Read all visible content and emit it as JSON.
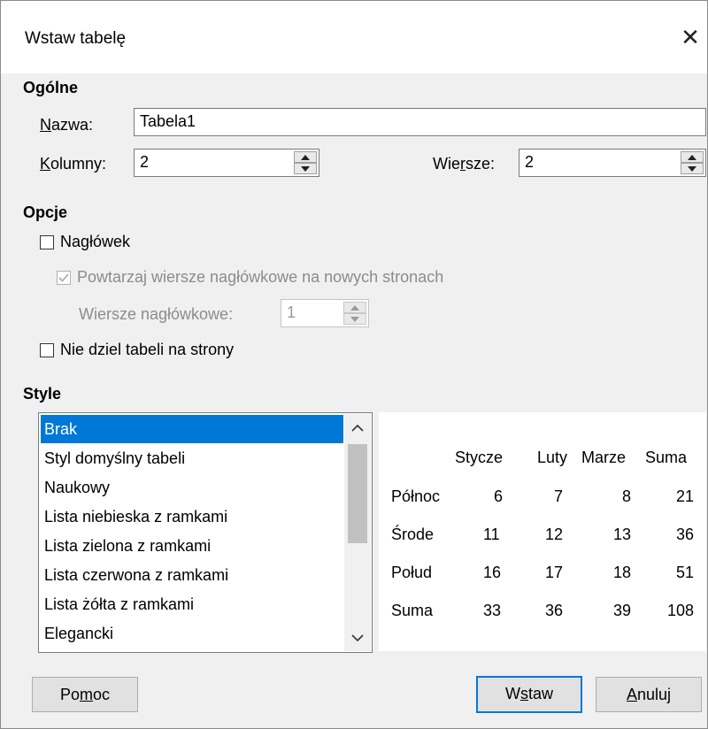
{
  "window": {
    "title": "Wstaw tabelę",
    "close_glyph": "✕"
  },
  "general": {
    "heading": "Ogólne",
    "name_label": "Nazwa:",
    "name_value": "Tabela1",
    "columns_label": "Kolumny:",
    "columns_value": "2",
    "rows_label": "Wiersze:",
    "rows_value": "2"
  },
  "options": {
    "heading": "Opcje",
    "header_checkbox": {
      "label": "Nagłówek",
      "checked": false
    },
    "repeat_header": {
      "label": "Powtarzaj wiersze nagłówkowe na nowych stronach",
      "checked": true,
      "disabled": true
    },
    "heading_rows_label": "Wiersze nagłówkowe:",
    "heading_rows_value": "1",
    "dont_split": {
      "label": "Nie dziel tabeli na strony",
      "checked": false
    }
  },
  "styles": {
    "heading": "Style",
    "items": [
      "Brak",
      "Styl domyślny tabeli",
      "Naukowy",
      "Lista niebieska z ramkami",
      "Lista zielona z ramkami",
      "Lista czerwona z ramkami",
      "Lista żółta z ramkami",
      "Elegancki"
    ],
    "selected_index": 0
  },
  "preview": {
    "columns": [
      "Stycze",
      "Luty",
      "Marze",
      "Suma"
    ],
    "rows": [
      {
        "label": "Północ",
        "values": [
          "6",
          "7",
          "8",
          "21"
        ]
      },
      {
        "label": "Środe",
        "values": [
          "11",
          "12",
          "13",
          "36"
        ]
      },
      {
        "label": "Połud",
        "values": [
          "16",
          "17",
          "18",
          "51"
        ]
      },
      {
        "label": "Suma",
        "values": [
          "33",
          "36",
          "39",
          "108"
        ]
      }
    ]
  },
  "buttons": {
    "help": "Pomoc",
    "insert": "Wstaw",
    "cancel": "Anuluj"
  },
  "colors": {
    "selection": "#0078d7",
    "dialog_bg": "#f0f0f0"
  }
}
